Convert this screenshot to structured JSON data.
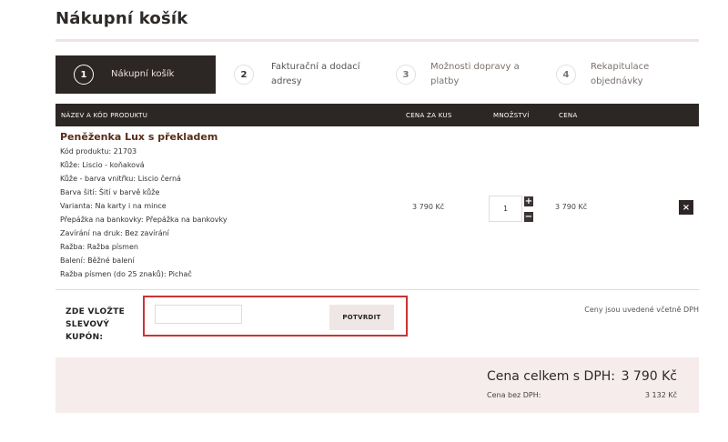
{
  "page_title": "Nákupní košík",
  "steps": [
    {
      "num": "1",
      "label": "Nákupní košík",
      "active": true
    },
    {
      "num": "2",
      "label_line1": "Fakturační a dodací",
      "label_line2": "adresy"
    },
    {
      "num": "3",
      "label_line1": "Možnosti dopravy a",
      "label_line2": "platby"
    },
    {
      "num": "4",
      "label_line1": "Rekapitulace",
      "label_line2": "objednávky"
    }
  ],
  "table_header": {
    "product": "NÁZEV A KÓD PRODUKTU",
    "unit_price": "CENA ZA KUS",
    "quantity": "MNOŽSTVÍ",
    "price": "CENA"
  },
  "product": {
    "name": "Peněženka Lux s překladem",
    "attributes": [
      "Kód produktu: 21703",
      "Kůže: Liscio - koňaková",
      "Kůže - barva vnitřku: Liscio černá",
      "Barva šití: Šití v barvě kůže",
      "Varianta: Na karty i na mince",
      "Přepážka na bankovky: Přepážka na bankovky",
      "Zavírání na druk: Bez zavírání",
      "Ražba: Ražba písmen",
      "Balení: Běžné balení",
      "Ražba písmen (do 25 znaků): Pichač"
    ],
    "unit_price": "3 790 Kč",
    "quantity": "1",
    "total_price": "3 790 Kč",
    "qty_plus": "+",
    "qty_minus": "−",
    "remove": "×"
  },
  "coupon": {
    "label_line1": "ZDE VLOŽTE",
    "label_line2": "SLEVOVÝ",
    "label_line3": "KUPÓN:",
    "input_value": "",
    "button_label": "POTVRDIT"
  },
  "vat_note": "Ceny jsou uvedené včetně DPH",
  "summary": {
    "total_label": "Cena celkem s DPH:",
    "total_value": "3 790 Kč",
    "net_label": "Cena bez DPH:",
    "net_value": "3 132 Kč"
  },
  "colors": {
    "dark": "#2c2624",
    "highlight": "#cc3333",
    "summary_bg": "#f6ecec",
    "product_name": "#5a2c18"
  }
}
